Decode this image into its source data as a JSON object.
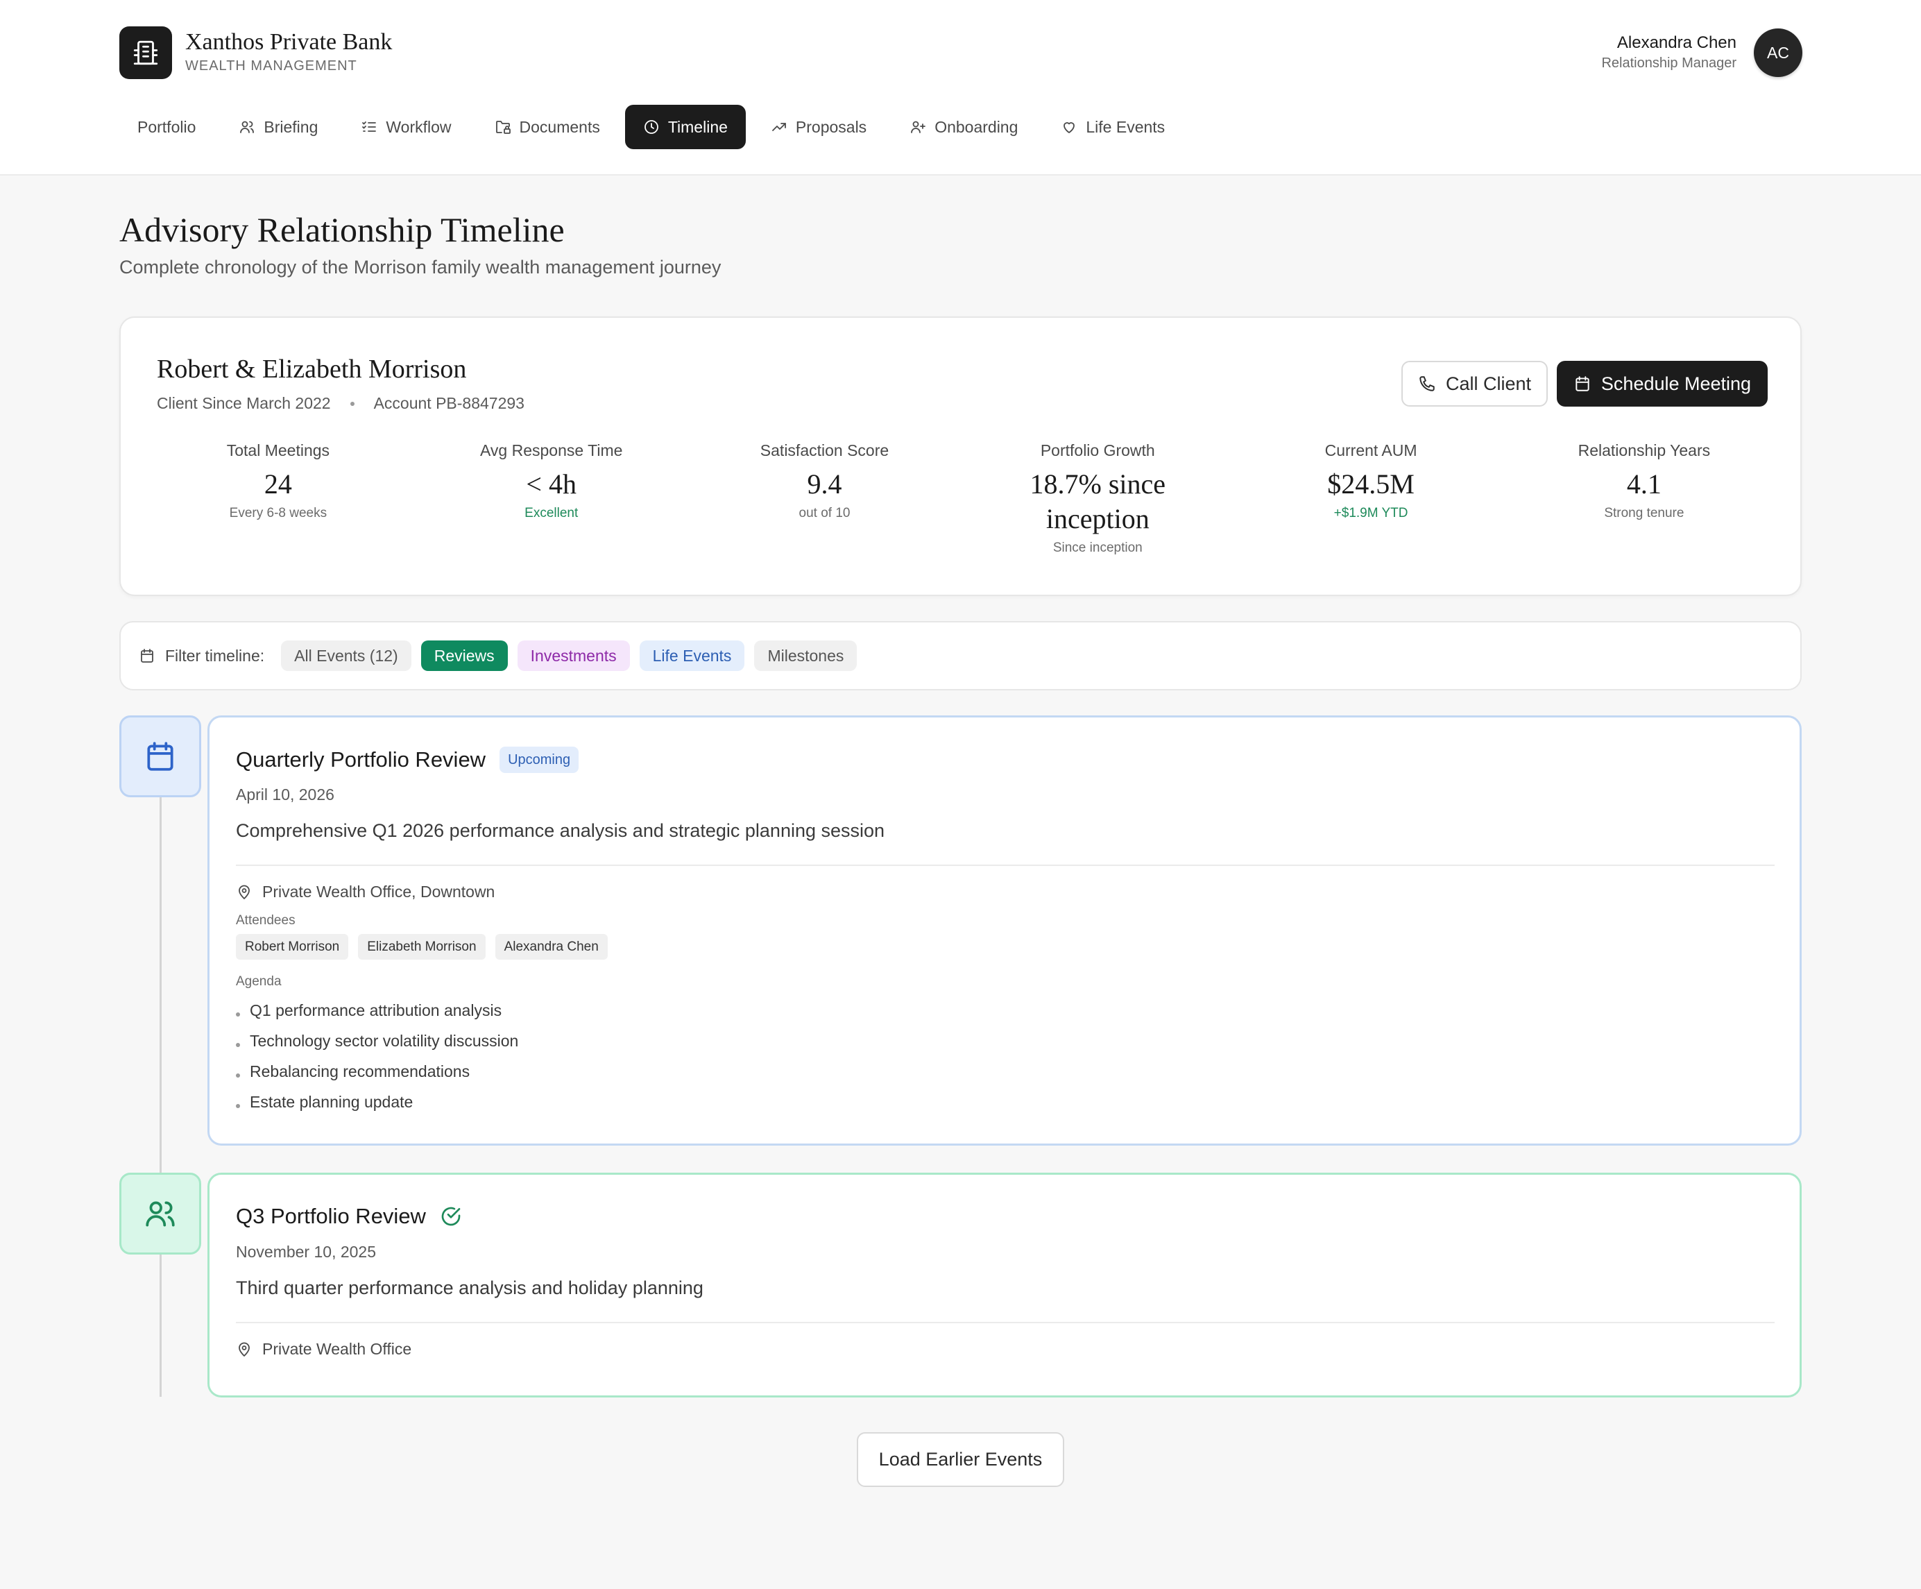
{
  "brand": {
    "name": "Xanthos Private Bank",
    "subtitle": "WEALTH MANAGEMENT"
  },
  "user": {
    "name": "Alexandra Chen",
    "role": "Relationship Manager",
    "initials": "AC"
  },
  "nav": {
    "items": [
      {
        "label": "Portfolio",
        "icon": "none"
      },
      {
        "label": "Briefing",
        "icon": "users-icon"
      },
      {
        "label": "Workflow",
        "icon": "checklist-icon"
      },
      {
        "label": "Documents",
        "icon": "folder-lock-icon"
      },
      {
        "label": "Timeline",
        "icon": "clock-icon",
        "active": true
      },
      {
        "label": "Proposals",
        "icon": "trending-up-icon"
      },
      {
        "label": "Onboarding",
        "icon": "user-plus-icon"
      },
      {
        "label": "Life Events",
        "icon": "heart-icon"
      }
    ]
  },
  "page": {
    "title": "Advisory Relationship Timeline",
    "subtitle": "Complete chronology of the Morrison family wealth management journey"
  },
  "client": {
    "name": "Robert & Elizabeth Morrison",
    "since": "Client Since March 2022",
    "account": "Account PB-8847293",
    "call_label": "Call Client",
    "schedule_label": "Schedule Meeting",
    "stats": [
      {
        "label": "Total Meetings",
        "value": "24",
        "note": "Every 6-8 weeks"
      },
      {
        "label": "Avg Response Time",
        "value": "< 4h",
        "note": "Excellent"
      },
      {
        "label": "Satisfaction Score",
        "value": "9.4",
        "note": "out of 10"
      },
      {
        "label": "Portfolio Growth",
        "value": "18.7% since inception",
        "note": "Since inception"
      },
      {
        "label": "Current AUM",
        "value": "$24.5M",
        "note": "+$1.9M YTD"
      },
      {
        "label": "Relationship Years",
        "value": "4.1",
        "note": "Strong tenure"
      }
    ]
  },
  "filter": {
    "label": "Filter timeline:",
    "chips": {
      "all": "All Events (12)",
      "reviews": "Reviews",
      "investments": "Investments",
      "life": "Life Events",
      "milestones": "Milestones"
    }
  },
  "events": [
    {
      "title": "Quarterly Portfolio Review",
      "badge": "Upcoming",
      "date": "April 10, 2026",
      "description": "Comprehensive Q1 2026 performance analysis and strategic planning session",
      "location": "Private Wealth Office, Downtown",
      "attendees_label": "Attendees",
      "attendees": [
        "Robert Morrison",
        "Elizabeth Morrison",
        "Alexandra Chen"
      ],
      "agenda_label": "Agenda",
      "agenda": [
        "Q1 performance attribution analysis",
        "Technology sector volatility discussion",
        "Rebalancing recommendations",
        "Estate planning update"
      ]
    },
    {
      "title": "Q3 Portfolio Review",
      "date": "November 10, 2025",
      "description": "Third quarter performance analysis and holiday planning",
      "location": "Private Wealth Office"
    }
  ],
  "load_more_label": "Load Earlier Events",
  "colors": {
    "primary": "#1c1c1c",
    "accent_green": "#0f8a5f",
    "upcoming_blue": "#2d5fb3",
    "completed_green": "#1e8a5a"
  }
}
